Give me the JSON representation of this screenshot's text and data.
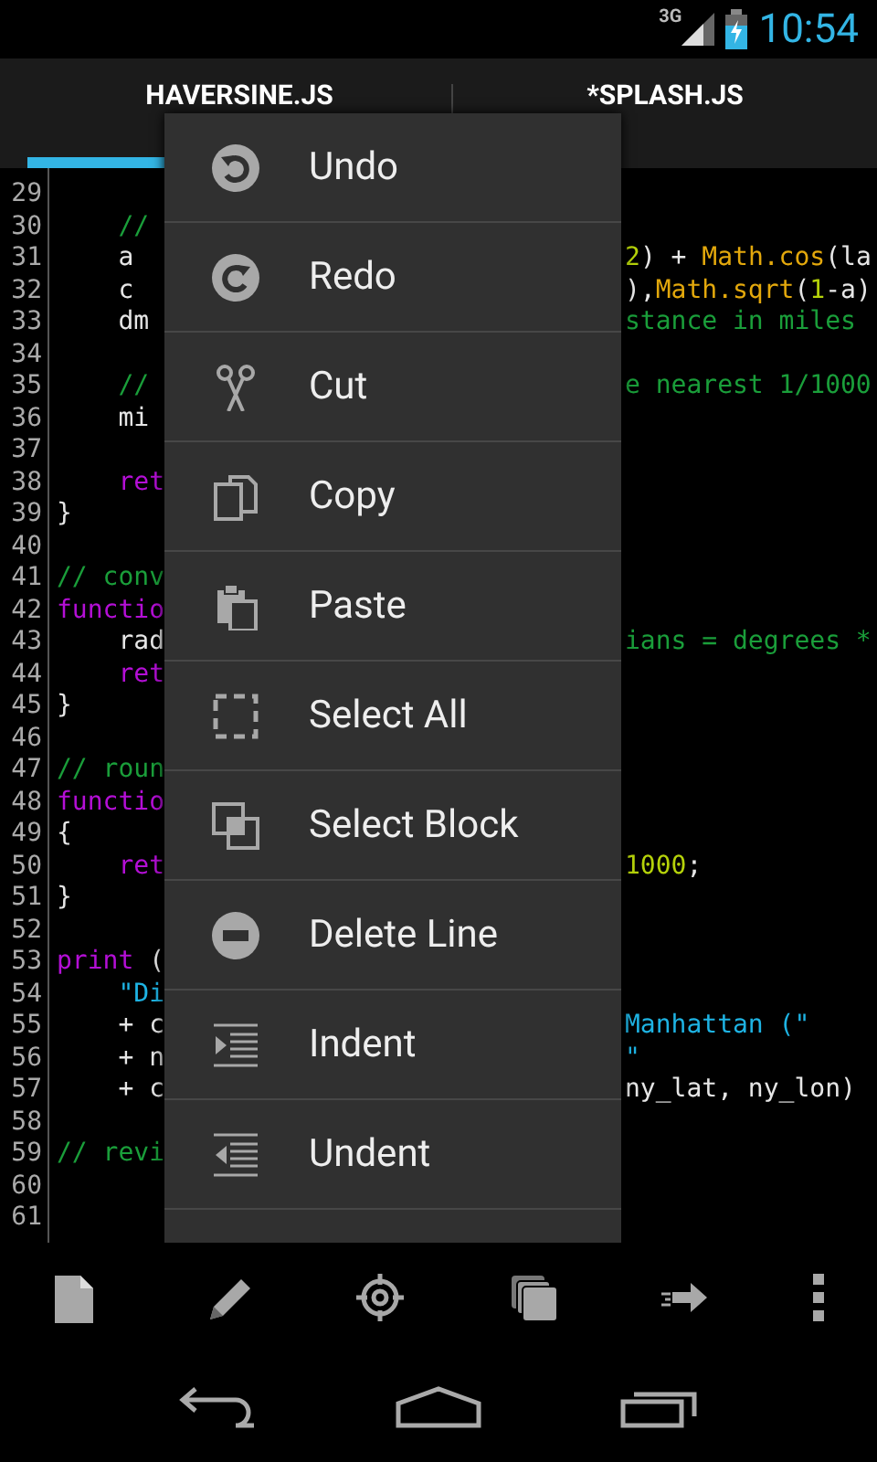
{
  "status_bar": {
    "network": "3G",
    "time": "10:54"
  },
  "tabs": [
    {
      "label": "HAVERSINE.JS",
      "selected": true
    },
    {
      "label": "*SPLASH.JS",
      "selected": false
    }
  ],
  "editor": {
    "lines": [
      {
        "number": "29"
      },
      {
        "number": "30",
        "left": [
          {
            "kind": "comment",
            "text": "    //"
          }
        ]
      },
      {
        "number": "31",
        "left": [
          {
            "kind": "plain",
            "text": "    a"
          }
        ],
        "right": [
          {
            "kind": "number",
            "text": "2"
          },
          {
            "kind": "plain",
            "text": ") + "
          },
          {
            "kind": "function",
            "text": "Math.cos"
          },
          {
            "kind": "plain",
            "text": "(la"
          }
        ]
      },
      {
        "number": "32",
        "left": [
          {
            "kind": "plain",
            "text": "    c"
          }
        ],
        "right": [
          {
            "kind": "plain",
            "text": "),"
          },
          {
            "kind": "function",
            "text": "Math.sqrt"
          },
          {
            "kind": "plain",
            "text": "("
          },
          {
            "kind": "number",
            "text": "1"
          },
          {
            "kind": "plain",
            "text": "-a)"
          }
        ]
      },
      {
        "number": "33",
        "left": [
          {
            "kind": "plain",
            "text": "    dm"
          }
        ],
        "right": [
          {
            "kind": "comment",
            "text": "stance in miles"
          }
        ]
      },
      {
        "number": "34"
      },
      {
        "number": "35",
        "left": [
          {
            "kind": "comment",
            "text": "    //"
          }
        ],
        "right": [
          {
            "kind": "comment",
            "text": "e nearest 1/1000"
          }
        ]
      },
      {
        "number": "36",
        "left": [
          {
            "kind": "plain",
            "text": "    mi"
          }
        ]
      },
      {
        "number": "37"
      },
      {
        "number": "38",
        "left": [
          {
            "kind": "keyword",
            "text": "    ret"
          }
        ]
      },
      {
        "number": "39",
        "left": [
          {
            "kind": "plain",
            "text": "}"
          }
        ]
      },
      {
        "number": "40"
      },
      {
        "number": "41",
        "left": [
          {
            "kind": "comment",
            "text": "// conv"
          }
        ]
      },
      {
        "number": "42",
        "left": [
          {
            "kind": "keyword",
            "text": "functio"
          }
        ]
      },
      {
        "number": "43",
        "left": [
          {
            "kind": "plain",
            "text": "    rad"
          }
        ],
        "right": [
          {
            "kind": "comment",
            "text": "ians = degrees *"
          }
        ]
      },
      {
        "number": "44",
        "left": [
          {
            "kind": "keyword",
            "text": "    ret"
          }
        ]
      },
      {
        "number": "45",
        "left": [
          {
            "kind": "plain",
            "text": "}"
          }
        ]
      },
      {
        "number": "46"
      },
      {
        "number": "47",
        "left": [
          {
            "kind": "comment",
            "text": "// roun"
          }
        ]
      },
      {
        "number": "48",
        "left": [
          {
            "kind": "keyword",
            "text": "functio"
          }
        ]
      },
      {
        "number": "49",
        "left": [
          {
            "kind": "plain",
            "text": "{"
          }
        ]
      },
      {
        "number": "50",
        "left": [
          {
            "kind": "keyword",
            "text": "    ret"
          }
        ],
        "right": [
          {
            "kind": "number",
            "text": "1000"
          },
          {
            "kind": "plain",
            "text": ";"
          }
        ]
      },
      {
        "number": "51",
        "left": [
          {
            "kind": "plain",
            "text": "}"
          }
        ]
      },
      {
        "number": "52"
      },
      {
        "number": "53",
        "left": [
          {
            "kind": "keyword",
            "text": "print"
          },
          {
            "kind": "plain",
            "text": " ("
          }
        ]
      },
      {
        "number": "54",
        "left": [
          {
            "kind": "string",
            "text": "    \"Di"
          }
        ]
      },
      {
        "number": "55",
        "left": [
          {
            "kind": "plain",
            "text": "    + c"
          }
        ],
        "right": [
          {
            "kind": "string",
            "text": "Manhattan (\""
          }
        ]
      },
      {
        "number": "56",
        "left": [
          {
            "kind": "plain",
            "text": "    + n"
          }
        ],
        "right": [
          {
            "kind": "string",
            "text": "\""
          }
        ]
      },
      {
        "number": "57",
        "left": [
          {
            "kind": "plain",
            "text": "    + c"
          }
        ],
        "right": [
          {
            "kind": "plain",
            "text": "ny_lat, ny_lon)"
          }
        ]
      },
      {
        "number": "58"
      },
      {
        "number": "59",
        "left": [
          {
            "kind": "comment",
            "text": "// revi"
          }
        ]
      },
      {
        "number": "60"
      },
      {
        "number": "61"
      }
    ]
  },
  "menu": {
    "items": [
      {
        "label": "Undo"
      },
      {
        "label": "Redo"
      },
      {
        "label": "Cut"
      },
      {
        "label": "Copy"
      },
      {
        "label": "Paste"
      },
      {
        "label": "Select All"
      },
      {
        "label": "Select Block"
      },
      {
        "label": "Delete Line"
      },
      {
        "label": "Indent"
      },
      {
        "label": "Undent"
      }
    ]
  }
}
